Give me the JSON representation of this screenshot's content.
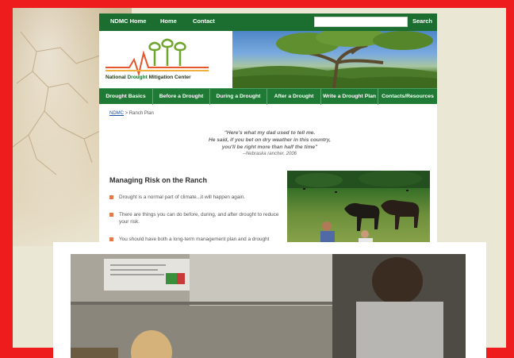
{
  "topnav": {
    "home": "NDMC Home",
    "home2": "Home",
    "contact": "Contact",
    "search_placeholder": "",
    "search_button": "Search"
  },
  "logo": {
    "national": "National",
    "drought": "Drought",
    "rest": "Mitigation Center"
  },
  "mainnav": [
    "Drought Basics",
    "Before a Drought",
    "During a Drought",
    "After a Drought",
    "Write a Drought Plan",
    "Contacts/Resources"
  ],
  "breadcrumb": {
    "root": "NDMC",
    "sep": " > ",
    "current": "Ranch Plan"
  },
  "quote": {
    "line1": "\"Here's what my dad used to tell me.",
    "line2": "He said, if you bet on dry weather in this country,",
    "line3": "you'll be right more than half the time\"",
    "attribution": "--Nebraska rancher, 2006"
  },
  "section": {
    "title": "Managing Risk on the Ranch",
    "bullets": [
      "Drought is a normal part of climate...it will happen again.",
      "There are things you can do before, during, and after drought to reduce your risk.",
      "You should have both a long-term management plan and a drought response plan, with trigger dates."
    ]
  },
  "colors": {
    "frame": "#ee1c1c",
    "nav_green": "#1b6e2f",
    "bullet": "#e27a4b"
  }
}
